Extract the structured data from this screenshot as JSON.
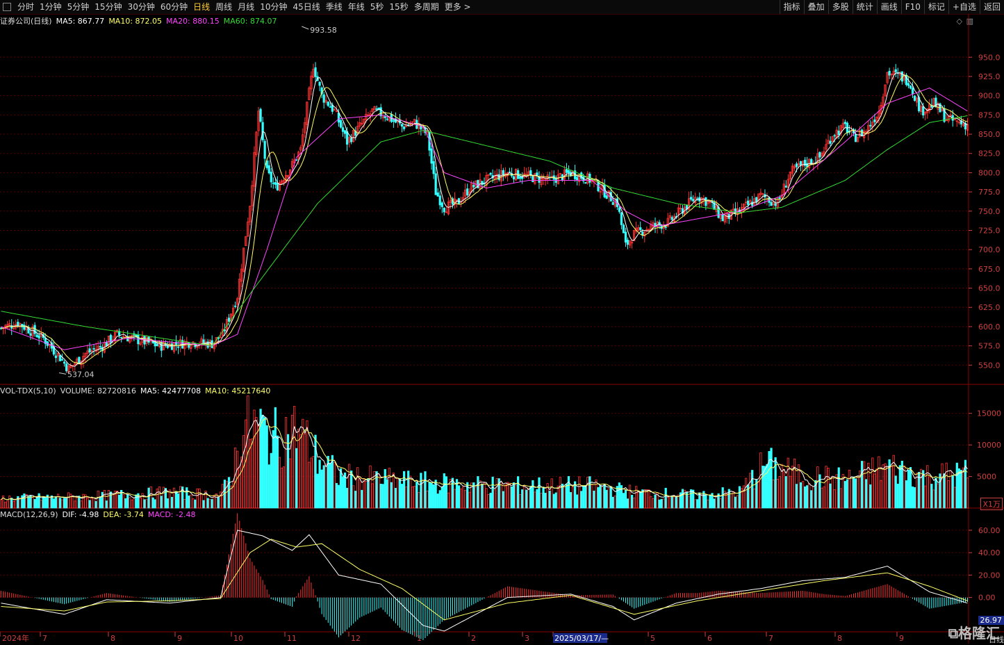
{
  "toolbar": {
    "items": [
      "分时",
      "1分钟",
      "5分钟",
      "15分钟",
      "30分钟",
      "60分钟",
      "日线",
      "周线",
      "月线",
      "10分钟",
      "45日线",
      "季线",
      "年线",
      "5秒",
      "15秒",
      "多周期",
      "更多 >"
    ],
    "active_index": 6,
    "right_items": [
      "指标",
      "叠加",
      "多股",
      "统计",
      "画线",
      "F10",
      "标记",
      "+自选",
      "返回"
    ]
  },
  "price_panel": {
    "name": "证券公司(日线)",
    "ma5": "MA5: 867.77",
    "ma10": "MA10: 872.05",
    "ma20": "MA20: 880.15",
    "ma60": "MA60: 874.07",
    "high_label": "993.58",
    "low_label": "537.04",
    "colors": {
      "ma5": "#ffffff",
      "ma10": "#ffff66",
      "ma20": "#ff44ff",
      "ma60": "#33dd33",
      "up": "#ff3333",
      "down": "#33ffff"
    }
  },
  "volume_panel": {
    "name": "VOL-TDX(5,10)",
    "volume": "VOLUME: 82720816",
    "ma5": "MA5: 42477708",
    "ma10": "MA10: 45217640",
    "unit": "X1万"
  },
  "macd_panel": {
    "name": "MACD(12,26,9)",
    "dif": "DIF: -4.98",
    "dea": "DEA: -3.74",
    "macd": "MACD: -2.48",
    "last_tag": "26.97"
  },
  "date_axis": {
    "labels": [
      "2024年",
      "7",
      "8",
      "9",
      "10",
      "11",
      "12",
      "1",
      "2",
      "3",
      "2025/03/17/—",
      "5",
      "6",
      "7",
      "8",
      "9"
    ],
    "last": "日线"
  },
  "chart_data": [
    {
      "type": "candlestick",
      "y_ticks": [
        "950.0",
        "925.0",
        "900.0",
        "875.0",
        "850.0",
        "825.0",
        "800.0",
        "775.0",
        "750.0",
        "725.0",
        "700.0",
        "675.0",
        "650.0",
        "625.0",
        "600.0",
        "575.0",
        "550.0"
      ],
      "ylim": [
        525,
        990
      ],
      "close_keypoints": [
        [
          0,
          598
        ],
        [
          8,
          605
        ],
        [
          20,
          585
        ],
        [
          28,
          560
        ],
        [
          32,
          545
        ],
        [
          40,
          565
        ],
        [
          48,
          575
        ],
        [
          55,
          590
        ],
        [
          62,
          585
        ],
        [
          75,
          575
        ],
        [
          90,
          580
        ],
        [
          100,
          578
        ],
        [
          105,
          590
        ],
        [
          112,
          640
        ],
        [
          118,
          760
        ],
        [
          122,
          880
        ],
        [
          126,
          800
        ],
        [
          130,
          780
        ],
        [
          138,
          810
        ],
        [
          142,
          830
        ],
        [
          148,
          940
        ],
        [
          152,
          900
        ],
        [
          158,
          880
        ],
        [
          164,
          840
        ],
        [
          170,
          860
        ],
        [
          176,
          880
        ],
        [
          182,
          875
        ],
        [
          190,
          860
        ],
        [
          196,
          865
        ],
        [
          202,
          850
        ],
        [
          206,
          775
        ],
        [
          210,
          755
        ],
        [
          216,
          760
        ],
        [
          222,
          780
        ],
        [
          230,
          790
        ],
        [
          240,
          800
        ],
        [
          250,
          795
        ],
        [
          260,
          790
        ],
        [
          270,
          800
        ],
        [
          280,
          790
        ],
        [
          288,
          770
        ],
        [
          292,
          760
        ],
        [
          296,
          705
        ],
        [
          300,
          720
        ],
        [
          308,
          730
        ],
        [
          316,
          735
        ],
        [
          324,
          755
        ],
        [
          330,
          770
        ],
        [
          336,
          760
        ],
        [
          342,
          740
        ],
        [
          350,
          750
        ],
        [
          360,
          770
        ],
        [
          368,
          760
        ],
        [
          374,
          800
        ],
        [
          380,
          810
        ],
        [
          388,
          820
        ],
        [
          394,
          850
        ],
        [
          400,
          860
        ],
        [
          404,
          845
        ],
        [
          410,
          855
        ],
        [
          416,
          880
        ],
        [
          420,
          930
        ],
        [
          426,
          925
        ],
        [
          430,
          920
        ],
        [
          436,
          880
        ],
        [
          442,
          890
        ],
        [
          448,
          870
        ],
        [
          454,
          865
        ],
        [
          458,
          862
        ]
      ],
      "ma20_keypoints": [
        [
          0,
          600
        ],
        [
          30,
          570
        ],
        [
          60,
          585
        ],
        [
          100,
          575
        ],
        [
          112,
          590
        ],
        [
          126,
          700
        ],
        [
          140,
          820
        ],
        [
          160,
          870
        ],
        [
          180,
          875
        ],
        [
          200,
          860
        ],
        [
          210,
          800
        ],
        [
          230,
          780
        ],
        [
          250,
          790
        ],
        [
          280,
          790
        ],
        [
          296,
          750
        ],
        [
          310,
          730
        ],
        [
          330,
          740
        ],
        [
          350,
          750
        ],
        [
          370,
          770
        ],
        [
          400,
          840
        ],
        [
          420,
          890
        ],
        [
          440,
          910
        ],
        [
          458,
          880
        ]
      ],
      "ma60_keypoints": [
        [
          0,
          620
        ],
        [
          40,
          600
        ],
        [
          100,
          575
        ],
        [
          120,
          650
        ],
        [
          150,
          760
        ],
        [
          180,
          840
        ],
        [
          200,
          855
        ],
        [
          230,
          835
        ],
        [
          260,
          815
        ],
        [
          290,
          780
        ],
        [
          320,
          760
        ],
        [
          350,
          748
        ],
        [
          370,
          755
        ],
        [
          400,
          790
        ],
        [
          420,
          830
        ],
        [
          440,
          865
        ],
        [
          458,
          874
        ]
      ]
    },
    {
      "type": "bar",
      "name": "VOLUME",
      "y_ticks": [
        "15000",
        "10000",
        "5000"
      ],
      "ylim": [
        0,
        17500
      ],
      "level_keypoints": [
        [
          0,
          1500
        ],
        [
          40,
          1800
        ],
        [
          80,
          2500
        ],
        [
          104,
          2000
        ],
        [
          110,
          6000
        ],
        [
          114,
          12000
        ],
        [
          120,
          13000
        ],
        [
          130,
          11000
        ],
        [
          140,
          12500
        ],
        [
          150,
          8000
        ],
        [
          160,
          5000
        ],
        [
          200,
          4000
        ],
        [
          240,
          3500
        ],
        [
          280,
          3500
        ],
        [
          300,
          2500
        ],
        [
          330,
          2000
        ],
        [
          350,
          2500
        ],
        [
          362,
          7000
        ],
        [
          380,
          5000
        ],
        [
          400,
          4500
        ],
        [
          420,
          6500
        ],
        [
          440,
          5000
        ],
        [
          458,
          5500
        ]
      ]
    },
    {
      "type": "line",
      "name": "MACD",
      "y_ticks": [
        "60.00",
        "40.00",
        "20.00",
        "0.00"
      ],
      "ylim": [
        -30,
        68
      ],
      "dif_keypoints": [
        [
          0,
          -5
        ],
        [
          30,
          -15
        ],
        [
          50,
          -2
        ],
        [
          80,
          -5
        ],
        [
          104,
          0
        ],
        [
          112,
          60
        ],
        [
          124,
          55
        ],
        [
          138,
          42
        ],
        [
          146,
          56
        ],
        [
          160,
          20
        ],
        [
          180,
          12
        ],
        [
          200,
          -25
        ],
        [
          210,
          -30
        ],
        [
          240,
          0
        ],
        [
          270,
          3
        ],
        [
          290,
          -8
        ],
        [
          300,
          -20
        ],
        [
          320,
          -5
        ],
        [
          340,
          3
        ],
        [
          360,
          8
        ],
        [
          380,
          15
        ],
        [
          400,
          18
        ],
        [
          420,
          28
        ],
        [
          440,
          5
        ],
        [
          458,
          -5
        ]
      ],
      "dea_keypoints": [
        [
          0,
          -8
        ],
        [
          30,
          -12
        ],
        [
          50,
          -4
        ],
        [
          80,
          -3
        ],
        [
          104,
          -1
        ],
        [
          118,
          40
        ],
        [
          128,
          52
        ],
        [
          140,
          45
        ],
        [
          152,
          48
        ],
        [
          170,
          25
        ],
        [
          190,
          8
        ],
        [
          210,
          -20
        ],
        [
          240,
          -5
        ],
        [
          270,
          2
        ],
        [
          300,
          -15
        ],
        [
          330,
          -3
        ],
        [
          360,
          6
        ],
        [
          390,
          15
        ],
        [
          420,
          22
        ],
        [
          440,
          10
        ],
        [
          458,
          -3
        ]
      ]
    }
  ]
}
